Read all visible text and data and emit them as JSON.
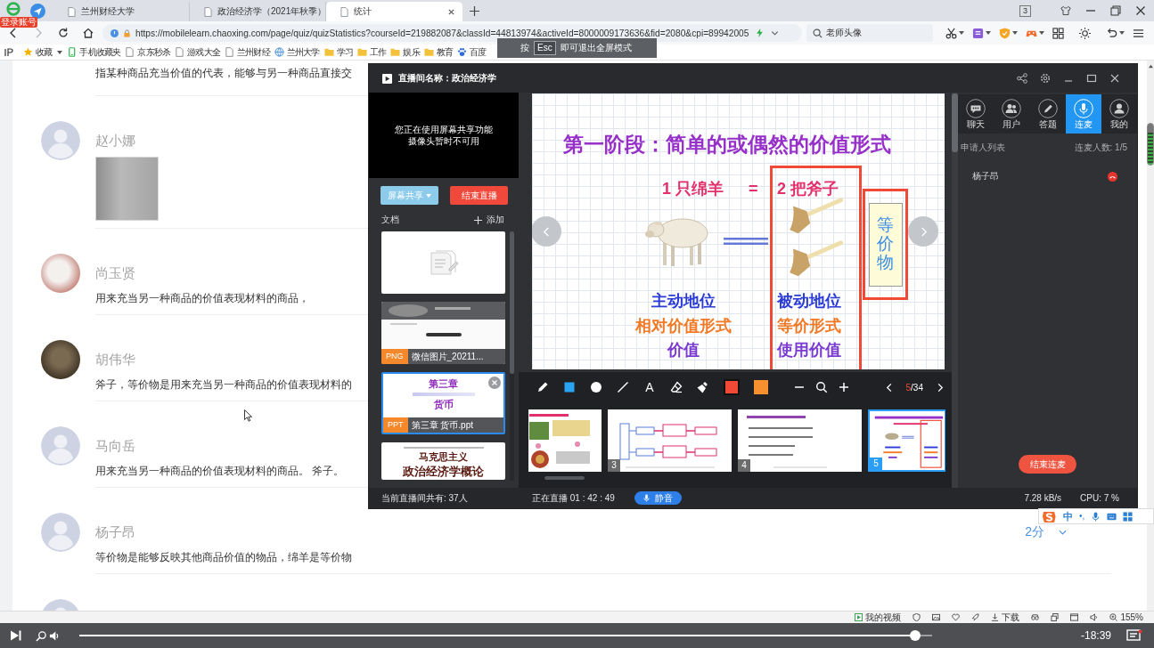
{
  "browser": {
    "login_badge": "登录账号",
    "tabs": [
      {
        "label": "兰州财经大学",
        "selected": false
      },
      {
        "label": "政治经济学（2021年秋季）",
        "selected": false
      },
      {
        "label": "统计",
        "selected": true
      }
    ],
    "window_badge": "3",
    "url": "https://mobilelearn.chaoxing.com/page/quiz/quizStatistics?courseId=219882087&classId=44813974&activeId=8000009173636&fid=2080&cpi=89942005",
    "search": {
      "value": "老师头像"
    },
    "bookmarks": [
      {
        "label": "收藏",
        "kind": "star"
      },
      {
        "label": "手机收藏夹",
        "kind": "phone"
      },
      {
        "label": "京东秒杀",
        "kind": "page"
      },
      {
        "label": "游戏大全",
        "kind": "page"
      },
      {
        "label": "兰州财经",
        "kind": "page"
      },
      {
        "label": "兰州大学",
        "kind": "globe"
      },
      {
        "label": "学习",
        "kind": "folder"
      },
      {
        "label": "工作",
        "kind": "folder"
      },
      {
        "label": "娱乐",
        "kind": "folder"
      },
      {
        "label": "教育",
        "kind": "folder"
      },
      {
        "label": "百度",
        "kind": "paw"
      }
    ],
    "fullscreen_notice": {
      "before": "按",
      "key": "Esc",
      "after": "即可退出全屏模式"
    }
  },
  "page": {
    "intro_text": "指某种商品充当价值的代表，能够与另一种商品直接交",
    "answers": [
      {
        "name": "赵小娜",
        "avatar": {
          "kind": "default"
        },
        "kind": "image"
      },
      {
        "name": "尚玉贤",
        "avatar": {
          "kind": "photo_light"
        },
        "kind": "text",
        "text": "用来充当另一种商品的价值表现材料的商品，"
      },
      {
        "name": "胡伟华",
        "avatar": {
          "kind": "photo_dark"
        },
        "kind": "text",
        "text": "斧子，等价物是用来充当另一种商品的价值表现材料的"
      },
      {
        "name": "马向岳",
        "avatar": {
          "kind": "default"
        },
        "kind": "text",
        "text": "用来充当另一种商品的价值表现材料的商品。 斧子。"
      },
      {
        "name": "杨子昂",
        "avatar": {
          "kind": "default"
        },
        "kind": "text",
        "text": "等价物是能够反映其他商品价值的物品，绵羊是等价物",
        "score": "2分"
      },
      {
        "avatar": {
          "kind": "default"
        },
        "kind": "partial"
      }
    ],
    "status_bar": {
      "videos": "我的视频",
      "download": "下载",
      "zoom": "155%"
    }
  },
  "player": {
    "level": 0.98,
    "time": "-18:39"
  },
  "ime": {
    "mode": "中",
    "punctuation": "•,"
  },
  "stream": {
    "title": "直播间名称：政治经济学",
    "camera_notice": [
      "您正在使用屏幕共享功能",
      "摄像头暂时不可用"
    ],
    "share_button": "屏幕共享",
    "end_live_button": "结束直播",
    "docs_label": "文档",
    "add_button": "添加",
    "docs": [
      {
        "kind": "blank",
        "selected": false
      },
      {
        "kind": "image",
        "type": "PNG",
        "name": "微信图片_20211...",
        "selected": false
      },
      {
        "kind": "slides",
        "type": "PPT",
        "name": "第三章 货币.ppt",
        "lines": [
          "第三章",
          "货币"
        ],
        "selected": true
      },
      {
        "kind": "cover",
        "lines": [
          "马克思主义",
          "政治经济学概论"
        ],
        "selected": false
      }
    ],
    "slide": {
      "title": "第一阶段：简单的或偶然的价值形式",
      "left_quantity": "1 只绵羊",
      "equals": "=",
      "right_quantity": "2 把斧子",
      "left_labels": [
        "主动地位",
        "相对价值形式",
        "价值"
      ],
      "right_labels": [
        "被动地位",
        "等价形式",
        "使用价值"
      ],
      "equivalent": "等价物"
    },
    "tools": [
      {
        "kind": "pencil"
      },
      {
        "kind": "rectangle"
      },
      {
        "kind": "circle"
      },
      {
        "kind": "line"
      },
      {
        "kind": "text",
        "label": "A"
      },
      {
        "kind": "eraser"
      },
      {
        "kind": "clear"
      },
      {
        "kind": "swatch",
        "color": "#f04a36",
        "selected": true
      },
      {
        "kind": "swatch",
        "color": "#f7902e",
        "selected": false
      }
    ],
    "page": {
      "current": "5",
      "total": "/34"
    },
    "thumbnails": [
      {
        "kind": "pictures",
        "selected": false
      },
      {
        "kind": "flowchart",
        "number": "3",
        "selected": false
      },
      {
        "kind": "list",
        "number": "4",
        "selected": false
      },
      {
        "kind": "diagram",
        "number": "5",
        "selected": true
      }
    ],
    "side_tabs": [
      {
        "label": "聊天",
        "kind": "chat",
        "selected": false
      },
      {
        "label": "用户",
        "kind": "users",
        "selected": false
      },
      {
        "label": "答题",
        "kind": "pen",
        "selected": false
      },
      {
        "label": "连麦",
        "kind": "mic",
        "selected": true
      },
      {
        "label": "我的",
        "kind": "person",
        "selected": false
      }
    ],
    "requests_label": "申请人列表",
    "mic_count": "连麦人数: 1/5",
    "mic_users": [
      {
        "name": "杨子昂"
      }
    ],
    "end_mic_button": "结束连麦",
    "viewers": "当前直播间共有: 37人",
    "live_time": "正在直播 01 : 42 : 49",
    "mute_button": "静音",
    "speed": "7.28 kB/s",
    "cpu": "CPU: 7 %"
  }
}
